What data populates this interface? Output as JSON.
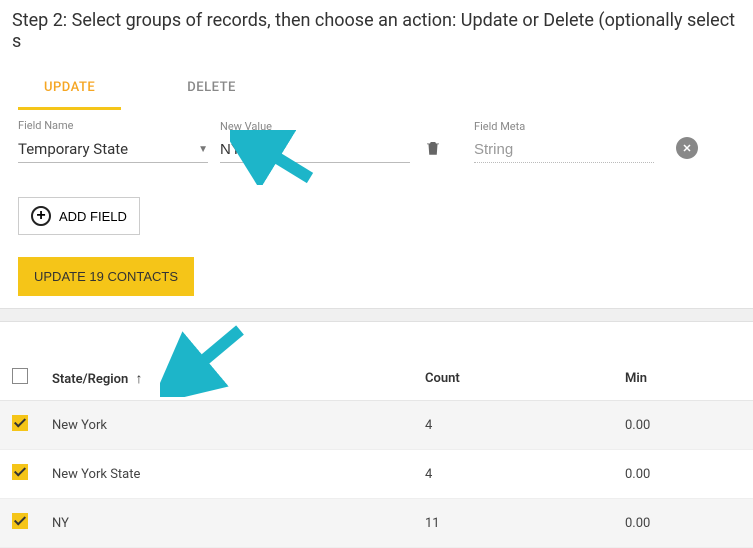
{
  "step_header": "Step 2: Select groups of records, then choose an action: Update or Delete (optionally select s",
  "tabs": {
    "update": "UPDATE",
    "delete": "DELETE"
  },
  "field_labels": {
    "name": "Field Name",
    "value": "New Value",
    "meta": "Field Meta"
  },
  "field_values": {
    "name": "Temporary State",
    "value": "NY",
    "meta": "String"
  },
  "buttons": {
    "add_field": "ADD FIELD",
    "update": "UPDATE 19 CONTACTS"
  },
  "table": {
    "headers": {
      "region": "State/Region",
      "count": "Count",
      "min": "Min"
    },
    "rows": [
      {
        "checked": true,
        "region": "New York",
        "count": "4",
        "min": "0.00"
      },
      {
        "checked": true,
        "region": "New York State",
        "count": "4",
        "min": "0.00"
      },
      {
        "checked": true,
        "region": "NY",
        "count": "11",
        "min": "0.00"
      }
    ]
  }
}
